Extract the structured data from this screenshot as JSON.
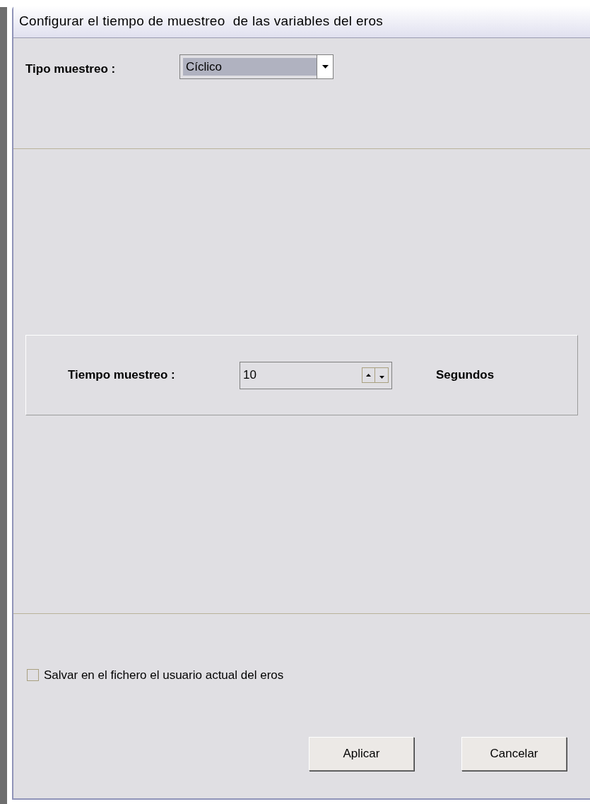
{
  "window": {
    "title": "Configurar el tiempo de muestreo  de las variables del eros"
  },
  "sampling_type": {
    "label": "Tipo muestreo :",
    "value": "Cíclico"
  },
  "sampling_time": {
    "label": "Tiempo muestreo :",
    "value": "10",
    "unit": "Segundos"
  },
  "save_checkbox": {
    "label": "Salvar en el fichero el usuario actual del eros",
    "checked": false
  },
  "buttons": [
    "Aplicar",
    "Cancelar"
  ]
}
